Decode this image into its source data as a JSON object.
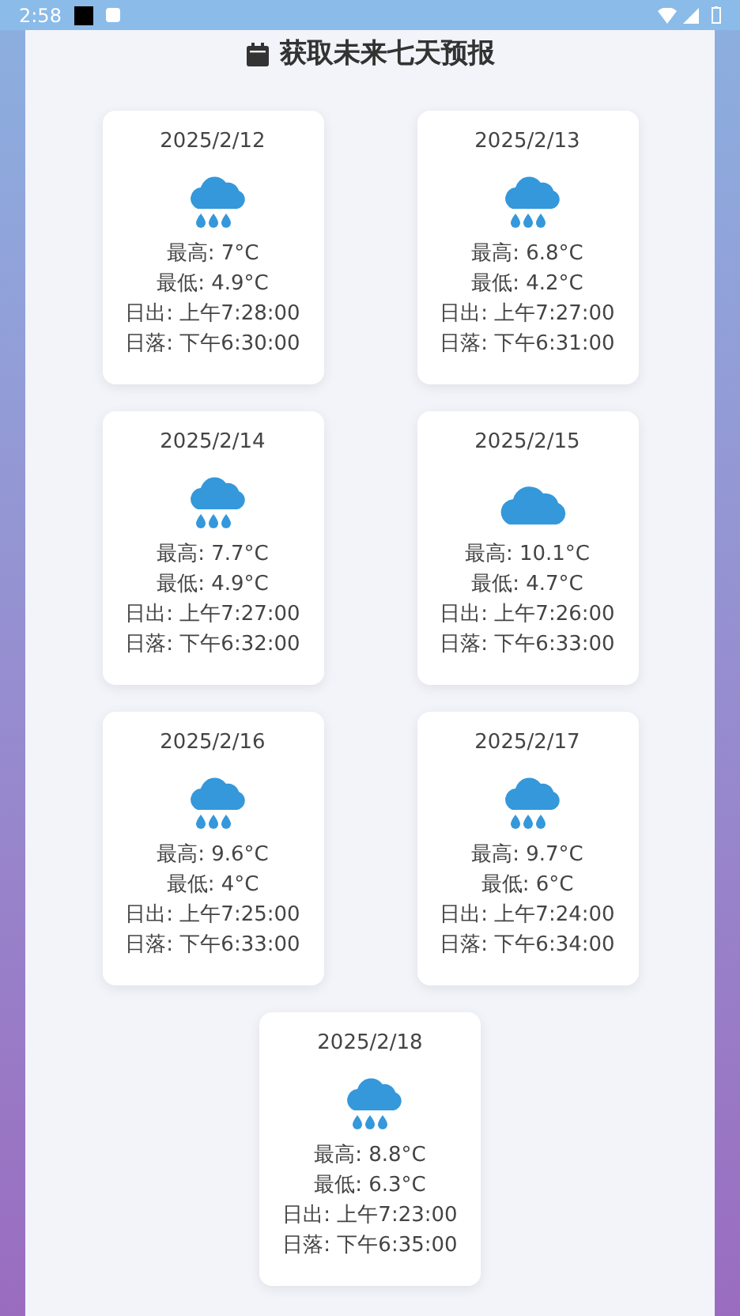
{
  "status_bar": {
    "time": "2:58"
  },
  "title": "获取未来七天预报",
  "days": [
    {
      "date": "2025/2/12",
      "kind": "rain",
      "high": "最高: 7°C",
      "low": "最低: 4.9°C",
      "sunrise": "日出: 上午7:28:00",
      "sunset": "日落: 下午6:30:00"
    },
    {
      "date": "2025/2/13",
      "kind": "rain",
      "high": "最高: 6.8°C",
      "low": "最低: 4.2°C",
      "sunrise": "日出: 上午7:27:00",
      "sunset": "日落: 下午6:31:00"
    },
    {
      "date": "2025/2/14",
      "kind": "rain",
      "high": "最高: 7.7°C",
      "low": "最低: 4.9°C",
      "sunrise": "日出: 上午7:27:00",
      "sunset": "日落: 下午6:32:00"
    },
    {
      "date": "2025/2/15",
      "kind": "cloud",
      "high": "最高: 10.1°C",
      "low": "最低: 4.7°C",
      "sunrise": "日出: 上午7:26:00",
      "sunset": "日落: 下午6:33:00"
    },
    {
      "date": "2025/2/16",
      "kind": "rain",
      "high": "最高: 9.6°C",
      "low": "最低: 4°C",
      "sunrise": "日出: 上午7:25:00",
      "sunset": "日落: 下午6:33:00"
    },
    {
      "date": "2025/2/17",
      "kind": "rain",
      "high": "最高: 9.7°C",
      "low": "最低: 6°C",
      "sunrise": "日出: 上午7:24:00",
      "sunset": "日落: 下午6:34:00"
    },
    {
      "date": "2025/2/18",
      "kind": "rain",
      "high": "最高: 8.8°C",
      "low": "最低: 6.3°C",
      "sunrise": "日出: 上午7:23:00",
      "sunset": "日落: 下午6:35:00"
    }
  ]
}
